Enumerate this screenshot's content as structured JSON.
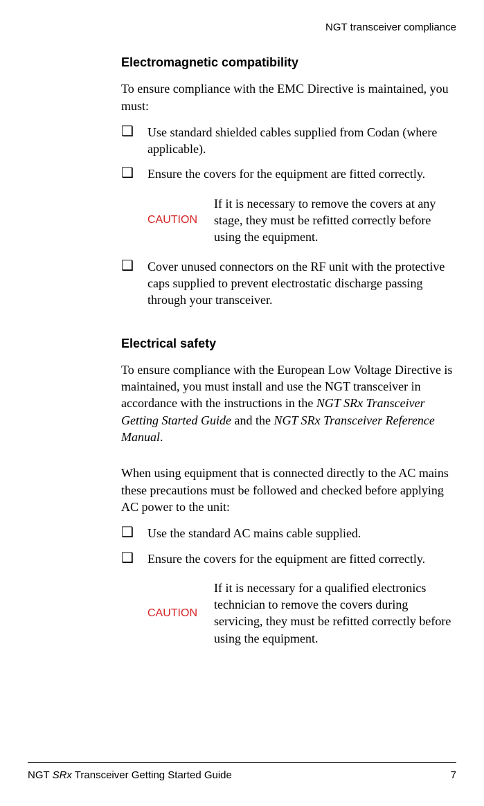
{
  "header": {
    "running_title": "NGT transceiver compliance"
  },
  "section1": {
    "heading": "Electromagnetic compatibility",
    "intro": "To ensure compliance with the EMC Directive is maintained, you must:",
    "item1": "Use standard shielded cables supplied from Codan (where applicable).",
    "item2": "Ensure the covers for the equipment are fitted correctly.",
    "caution_label": "CAUTION",
    "caution_text": "If it is necessary to remove the covers at any stage, they must be refitted correctly before using the equipment.",
    "item3": "Cover unused connectors on the RF unit with the protective caps supplied to prevent electrostatic discharge passing through your transceiver."
  },
  "section2": {
    "heading": "Electrical safety",
    "para_pre": "To ensure compliance with the European Low Voltage Directive is maintained, you must install and use the NGT transceiver in accordance with the instructions in the ",
    "doc1_italic": "NGT SRx Transceiver Getting Started Guide",
    "para_mid": " and the ",
    "doc2_italic": "NGT SRx Transceiver Reference Manual",
    "para_end": ".",
    "para2": "When using equipment that is connected directly to the AC mains these precautions must be followed and checked before applying AC power to the unit:",
    "item1": "Use the standard AC mains cable supplied.",
    "item2": "Ensure the covers for the equipment are fitted correctly.",
    "caution_label": "CAUTION",
    "caution_text": "If it is necessary for a qualified electronics technician to remove the covers during servicing, they must be refitted correctly before using the equipment."
  },
  "footer": {
    "prefix": "NGT ",
    "italic_part": "SRx",
    "suffix": " Transceiver Getting Started Guide",
    "page_number": "7"
  },
  "glyphs": {
    "checkbox": "❑"
  }
}
